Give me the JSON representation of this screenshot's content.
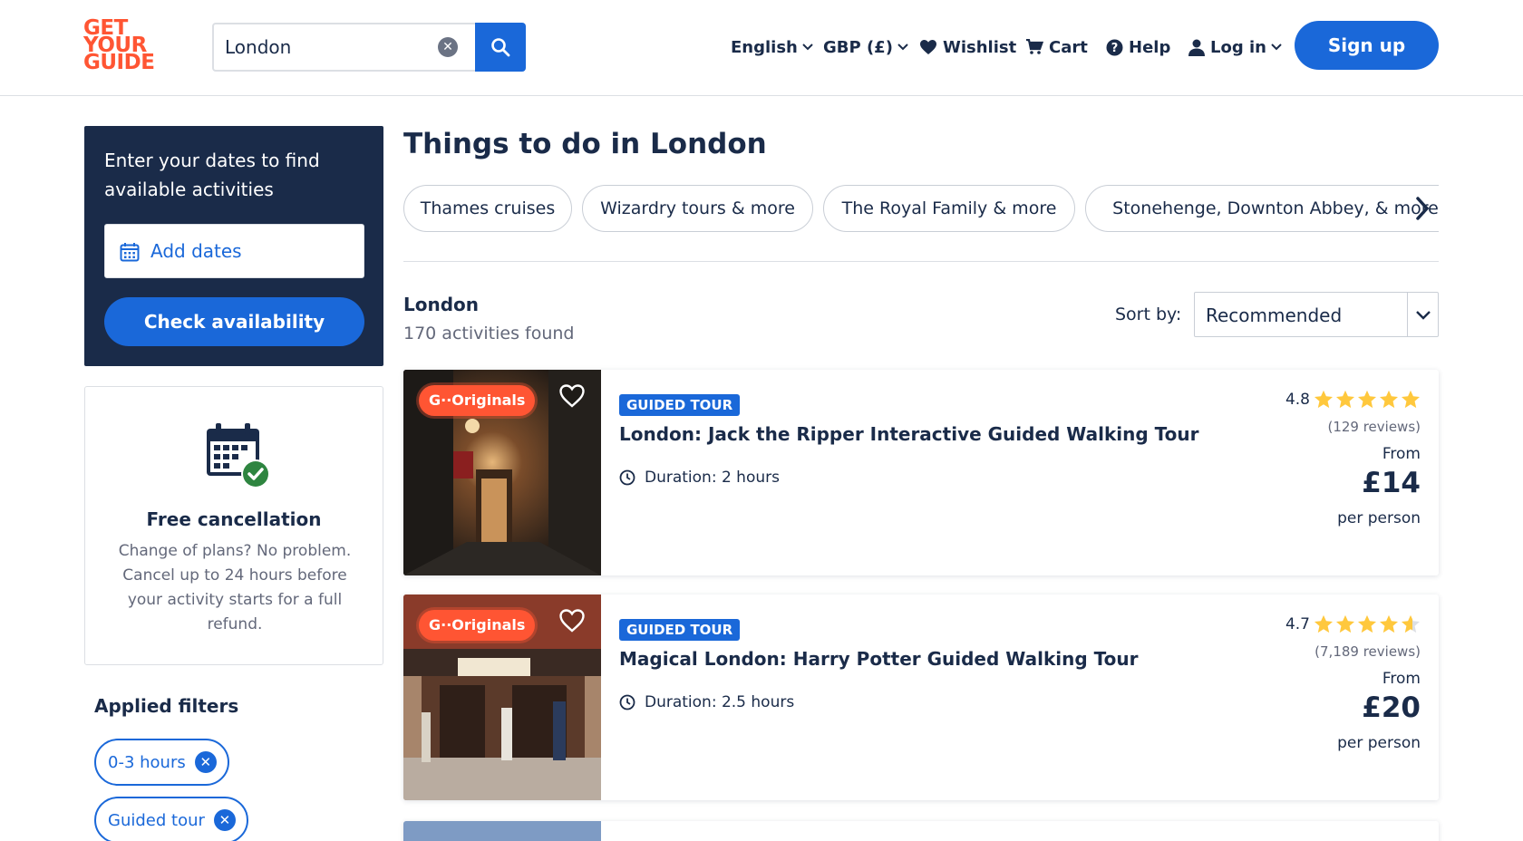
{
  "header": {
    "logo_lines": [
      "GET",
      "YOUR",
      "GUIDE"
    ],
    "search": {
      "value": "London",
      "placeholder": ""
    },
    "nav": {
      "language": "English",
      "currency": "GBP (£)",
      "wishlist": "Wishlist",
      "cart": "Cart",
      "help": "Help",
      "login": "Log in"
    },
    "signup_label": "Sign up"
  },
  "sidebar": {
    "dates_title": "Enter your dates to find available activities",
    "add_dates_label": "Add dates",
    "check_label": "Check availability",
    "free_cancel_title": "Free cancellation",
    "free_cancel_text": "Change of plans? No problem. Cancel up to 24 hours before your activity starts for a full refund.",
    "applied_title": "Applied filters",
    "filters": [
      {
        "label": "0-3 hours"
      },
      {
        "label": "Guided tour"
      }
    ]
  },
  "main": {
    "title": "Things to do in London",
    "categories": [
      {
        "label": "Thames cruises"
      },
      {
        "label": "Wizardry tours & more"
      },
      {
        "label": "The Royal Family & more"
      },
      {
        "label": "Stonehenge, Downton Abbey, & more"
      }
    ],
    "location": "London",
    "count": "170 activities found",
    "sort_label": "Sort by:",
    "sort_value": "Recommended",
    "activities": [
      {
        "badge": "G··Originals",
        "type": "GUIDED TOUR",
        "title": "London: Jack the Ripper Interactive Guided Walking Tour",
        "duration": "Duration: 2 hours",
        "rating": "4.8",
        "rating_value": 4.8,
        "reviews": "(129 reviews)",
        "from": "From",
        "price": "£14",
        "per": "per person"
      },
      {
        "badge": "G··Originals",
        "type": "GUIDED TOUR",
        "title": "Magical London: Harry Potter Guided Walking Tour",
        "duration": "Duration: 2.5 hours",
        "rating": "4.7",
        "rating_value": 4.7,
        "reviews": "(7,189 reviews)",
        "from": "From",
        "price": "£20",
        "per": "per person"
      }
    ]
  },
  "colors": {
    "brand_orange": "#ff5533",
    "primary_blue": "#1a68d9",
    "navy": "#1a2b49",
    "star": "#ffc83d"
  }
}
